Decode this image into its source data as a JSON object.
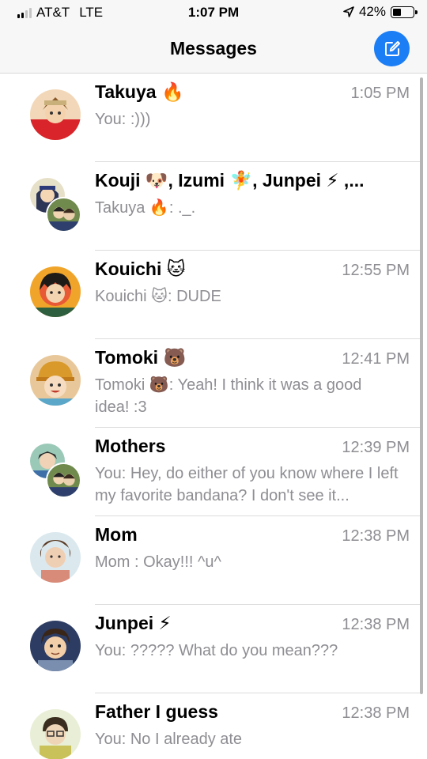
{
  "status_bar": {
    "carrier": "AT&T",
    "network": "LTE",
    "time": "1:07 PM",
    "battery": "42%",
    "battery_level": 0.42,
    "signal_bars": 2,
    "signal_total": 4
  },
  "nav": {
    "title": "Messages",
    "compose_icon": "compose-icon"
  },
  "accent": "#1c7ef5",
  "conversations": [
    {
      "name": "Takuya 🔥",
      "time": "1:05 PM",
      "preview": "You: :)))"
    },
    {
      "name": "Kouji 🐶, Izumi 🧚, Junpei ⚡ ,...",
      "time": "",
      "preview": "Takuya 🔥: ._."
    },
    {
      "name": "Kouichi 🐱",
      "time": "12:55 PM",
      "preview": "Kouichi 🐱: DUDE"
    },
    {
      "name": "Tomoki 🐻",
      "time": "12:41 PM",
      "preview": "Tomoki 🐻: Yeah! I think it was a good idea! :3"
    },
    {
      "name": "Mothers",
      "time": "12:39 PM",
      "preview": "You: Hey, do either of you know where I left my favorite bandana? I don't see it..."
    },
    {
      "name": "Mom",
      "time": "12:38 PM",
      "preview": "Mom : Okay!!! ^u^"
    },
    {
      "name": "Junpei ⚡",
      "time": "12:38 PM",
      "preview": "You: ????? What do you mean???"
    },
    {
      "name": "Father I guess",
      "time": "12:38 PM",
      "preview": "You: No I already ate"
    }
  ]
}
